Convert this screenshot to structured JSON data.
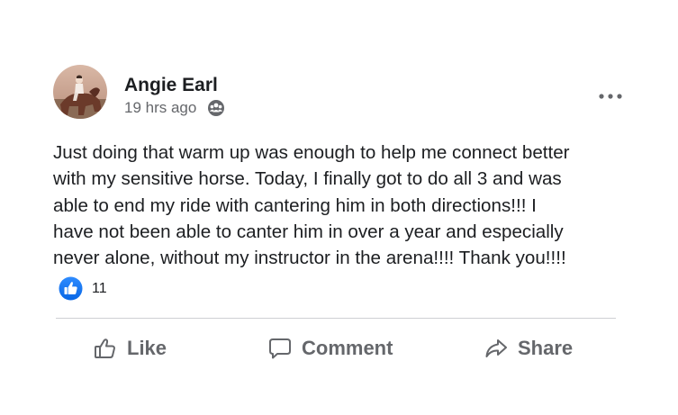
{
  "post": {
    "author": "Angie Earl",
    "timestamp": "19 hrs ago",
    "audience_icon": "friends-icon",
    "body_lines": [
      "Just doing that warm up was enough to help me connect better",
      "with my sensitive horse. Today, I finally got to do all 3 and was",
      "able to end my ride with cantering him in both directions!!! I",
      "have not been able to canter him in over a year and especially",
      "never alone, without my instructor in the arena!!!! Thank you!!!!"
    ]
  },
  "reactions": {
    "icon": "like-icon",
    "count": "11"
  },
  "actions": {
    "like": "Like",
    "comment": "Comment",
    "share": "Share"
  },
  "colors": {
    "text_primary": "#1c1e21",
    "text_secondary": "#65676b",
    "like_blue": "#1877f2",
    "divider": "#ced0d4"
  }
}
